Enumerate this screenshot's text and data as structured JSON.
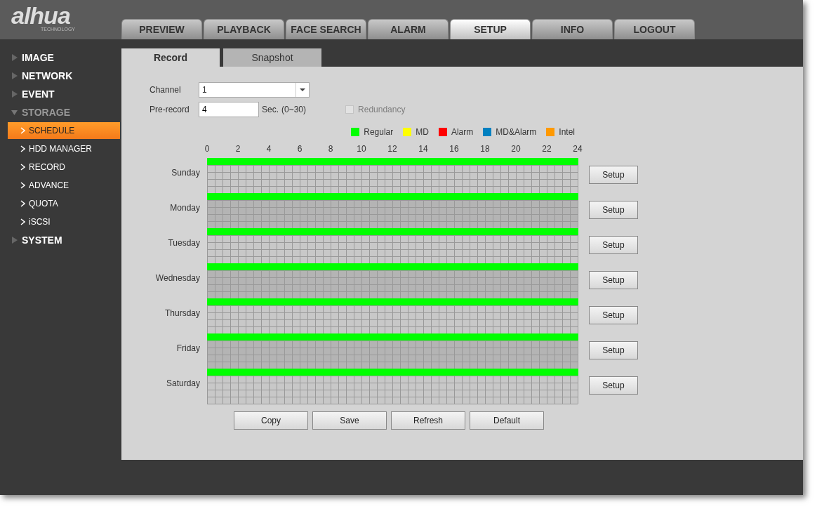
{
  "logo": {
    "name": "alhua",
    "tagline": "TECHNOLOGY"
  },
  "top_tabs": [
    {
      "label": "PREVIEW",
      "selected": false
    },
    {
      "label": "PLAYBACK",
      "selected": false
    },
    {
      "label": "FACE SEARCH",
      "selected": false
    },
    {
      "label": "ALARM",
      "selected": false
    },
    {
      "label": "SETUP",
      "selected": true
    },
    {
      "label": "INFO",
      "selected": false
    },
    {
      "label": "LOGOUT",
      "selected": false
    }
  ],
  "sidebar": {
    "items": [
      {
        "label": "IMAGE",
        "expanded": false
      },
      {
        "label": "NETWORK",
        "expanded": false
      },
      {
        "label": "EVENT",
        "expanded": false
      },
      {
        "label": "STORAGE",
        "expanded": true,
        "children": [
          {
            "label": "SCHEDULE",
            "selected": true
          },
          {
            "label": "HDD MANAGER",
            "selected": false
          },
          {
            "label": "RECORD",
            "selected": false
          },
          {
            "label": "ADVANCE",
            "selected": false
          },
          {
            "label": "QUOTA",
            "selected": false
          },
          {
            "label": "iSCSI",
            "selected": false
          }
        ]
      },
      {
        "label": "SYSTEM",
        "expanded": false
      }
    ]
  },
  "sub_tabs": [
    {
      "label": "Record",
      "selected": true
    },
    {
      "label": "Snapshot",
      "selected": false
    }
  ],
  "form": {
    "channel": {
      "label": "Channel",
      "value": "1"
    },
    "pre_record": {
      "label": "Pre-record",
      "value": "4",
      "unit": "Sec.",
      "range": "(0~30)"
    },
    "redundancy": {
      "label": "Redundancy",
      "checked": false,
      "disabled": true
    }
  },
  "schedule": {
    "chart_data": {
      "type": "bar",
      "orientation": "horizontal",
      "categories": [
        "Sunday",
        "Monday",
        "Tuesday",
        "Wednesday",
        "Thursday",
        "Friday",
        "Saturday"
      ],
      "series": [
        {
          "name": "Regular",
          "color": "#00ff00",
          "values": [
            24,
            24,
            24,
            24,
            24,
            24,
            24
          ]
        },
        {
          "name": "MD",
          "color": "#ffff00",
          "values": [
            0,
            0,
            0,
            0,
            0,
            0,
            0
          ]
        },
        {
          "name": "Alarm",
          "color": "#ff0000",
          "values": [
            0,
            0,
            0,
            0,
            0,
            0,
            0
          ]
        },
        {
          "name": "MD&Alarm",
          "color": "#0080c0",
          "values": [
            0,
            0,
            0,
            0,
            0,
            0,
            0
          ]
        },
        {
          "name": "Intel",
          "color": "#ff9900",
          "values": [
            0,
            0,
            0,
            0,
            0,
            0,
            0
          ]
        }
      ],
      "grid": true,
      "xlim": [
        0,
        24
      ],
      "xticks": [
        0,
        2,
        4,
        6,
        8,
        10,
        12,
        14,
        16,
        18,
        20,
        22,
        24
      ]
    },
    "setup_buttons": [
      "Setup",
      "Setup",
      "Setup",
      "Setup",
      "Setup",
      "Setup",
      "Setup"
    ]
  },
  "buttons": [
    "Copy",
    "Save",
    "Refresh",
    "Default"
  ]
}
